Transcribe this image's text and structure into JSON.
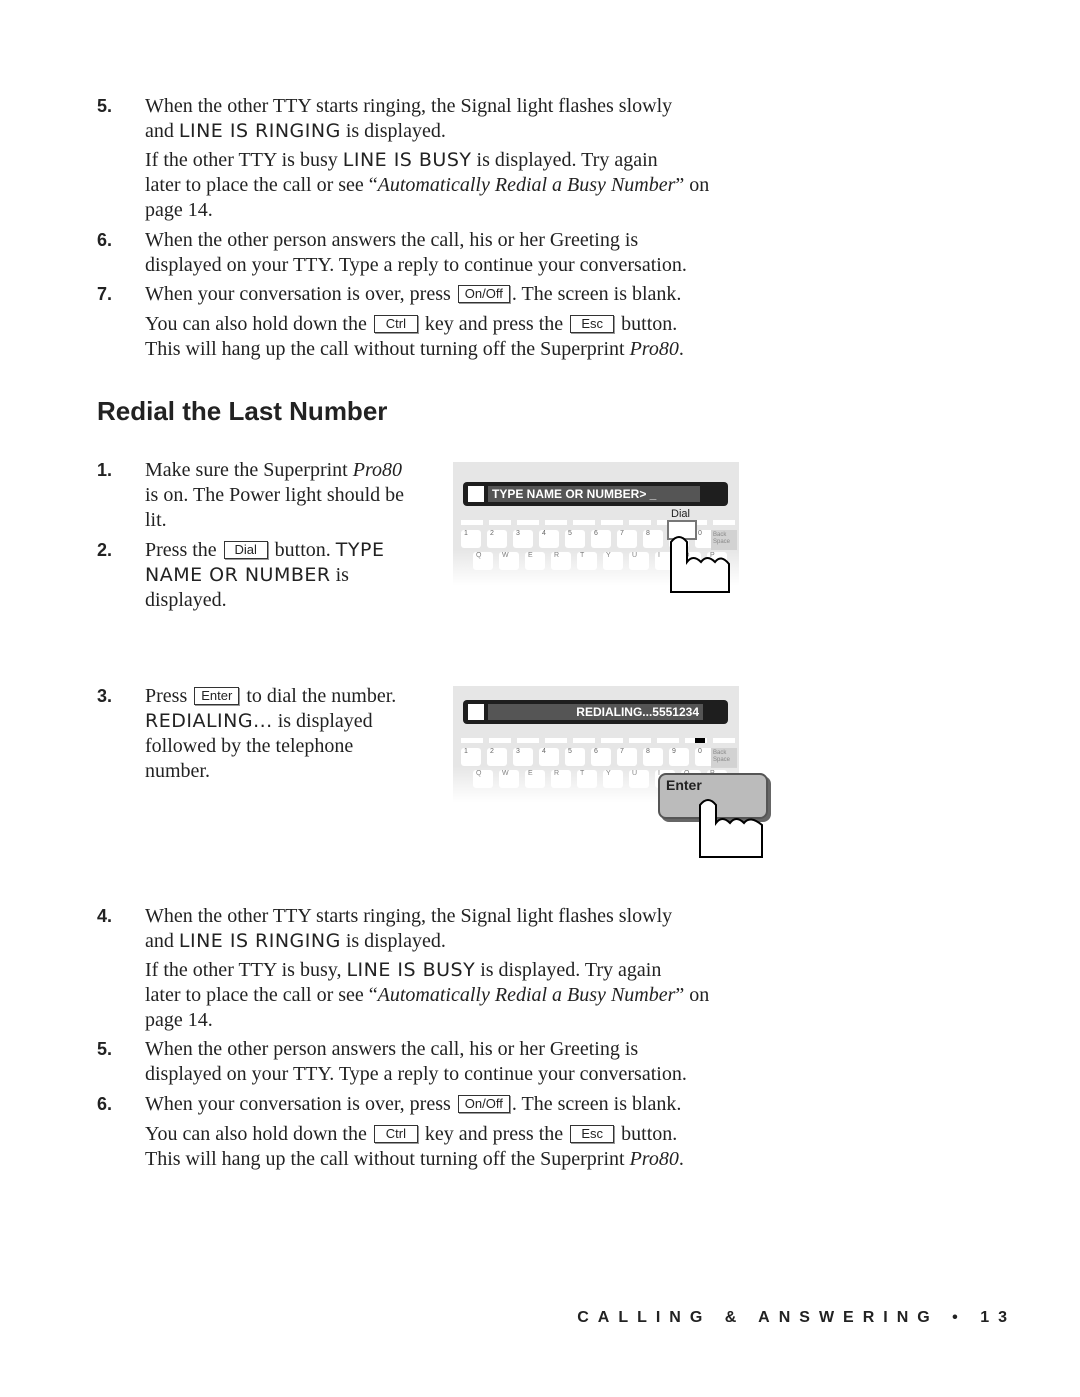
{
  "top_steps": [
    {
      "num": "5.",
      "lines": [
        [
          {
            "text": "When the other TTY starts ringing, the Signal light flashes slowly"
          }
        ],
        [
          {
            "text": "and "
          },
          {
            "lcd": "LINE IS RINGING"
          },
          {
            "text": " is displayed."
          }
        ]
      ]
    },
    {
      "num": "",
      "lines": [
        [
          {
            "text": "If the other TTY is busy "
          },
          {
            "lcd": "LINE IS BUSY"
          },
          {
            "text": " is displayed. Try again"
          }
        ],
        [
          {
            "text": "later to place the call or see “"
          },
          {
            "em": "Automatically Redial a Busy Number"
          },
          {
            "text": "” on"
          }
        ],
        [
          {
            "text": "page 14."
          }
        ]
      ]
    },
    {
      "num": "6.",
      "lines": [
        [
          {
            "text": "When the other person answers the call, his or her Greeting is"
          }
        ],
        [
          {
            "text": "displayed on your TTY. Type a reply to continue your conversation."
          }
        ]
      ]
    },
    {
      "num": "7.",
      "lines": [
        [
          {
            "text": "When your conversation is over, press "
          },
          {
            "key": "On/Off"
          },
          {
            "text": ". The screen is blank."
          }
        ]
      ]
    },
    {
      "num": "",
      "lines": [
        [
          {
            "text": "You can also hold down the "
          },
          {
            "key": "Ctrl"
          },
          {
            "text": " key and press the "
          },
          {
            "key": "Esc"
          },
          {
            "text": " button."
          }
        ],
        [
          {
            "text": "This will hang up the call without turning off the Superprint "
          },
          {
            "em": "Pro80"
          },
          {
            "text": "."
          }
        ]
      ]
    }
  ],
  "heading": "Redial the Last Number",
  "mid_steps": [
    {
      "num": "1.",
      "lines": [
        [
          {
            "text": "Make sure the Superprint "
          },
          {
            "em": "Pro80"
          }
        ],
        [
          {
            "text": "is on. The Power light should be"
          }
        ],
        [
          {
            "text": "lit."
          }
        ]
      ]
    },
    {
      "num": "2.",
      "lines": [
        [
          {
            "text": "Press the "
          },
          {
            "key": "Dial"
          },
          {
            "text": " button. "
          },
          {
            "lcd": "TYPE"
          }
        ],
        [
          {
            "lcd": "NAME OR NUMBER"
          },
          {
            "text": " is"
          }
        ],
        [
          {
            "text": "displayed."
          }
        ]
      ]
    },
    {
      "num": "3.",
      "lines": [
        [
          {
            "text": "Press "
          },
          {
            "key": "Enter"
          },
          {
            "text": " to dial the number."
          }
        ],
        [
          {
            "lcd": "REDIALING..."
          },
          {
            "text": " is displayed"
          }
        ],
        [
          {
            "text": "followed by the telephone"
          }
        ],
        [
          {
            "text": "number."
          }
        ]
      ]
    }
  ],
  "bottom_steps": [
    {
      "num": "4.",
      "lines": [
        [
          {
            "text": "When the other TTY starts ringing, the Signal light flashes slowly"
          }
        ],
        [
          {
            "text": "and "
          },
          {
            "lcd": "LINE IS RINGING"
          },
          {
            "text": " is displayed."
          }
        ]
      ]
    },
    {
      "num": "",
      "lines": [
        [
          {
            "text": "If the other TTY is busy, "
          },
          {
            "lcd": "LINE IS BUSY"
          },
          {
            "text": " is displayed. Try again"
          }
        ],
        [
          {
            "text": "later to place the call or see “"
          },
          {
            "em": "Automatically Redial a Busy Number"
          },
          {
            "text": "” on"
          }
        ],
        [
          {
            "text": "page 14."
          }
        ]
      ]
    },
    {
      "num": "5.",
      "lines": [
        [
          {
            "text": "When the other person answers the call, his or her Greeting is"
          }
        ],
        [
          {
            "text": "displayed on your TTY. Type a reply to continue your conversation."
          }
        ]
      ]
    },
    {
      "num": "6.",
      "lines": [
        [
          {
            "text": "When your conversation is over, press "
          },
          {
            "key": "On/Off"
          },
          {
            "text": ". The screen is blank."
          }
        ]
      ]
    },
    {
      "num": "",
      "lines": [
        [
          {
            "text": "You can also hold down the "
          },
          {
            "key": "Ctrl"
          },
          {
            "text": " key and press the "
          },
          {
            "key": "Esc"
          },
          {
            "text": " button."
          }
        ],
        [
          {
            "text": "This will hang up the call without turning off the Superprint "
          },
          {
            "em": "Pro80"
          },
          {
            "text": "."
          }
        ]
      ]
    }
  ],
  "illustration1": {
    "lcd_text": "TYPE NAME OR NUMBER> _",
    "key_label": "Dial",
    "row1": [
      "1",
      "2",
      "3",
      "4",
      "5",
      "6",
      "7",
      "8",
      "9",
      "0"
    ],
    "row2": [
      "Q",
      "W",
      "E",
      "R",
      "T",
      "Y",
      "U",
      "I",
      "O",
      "P"
    ],
    "backspace": "Back Space"
  },
  "illustration2": {
    "lcd_text": "REDIALING...5551234",
    "key_label": "Enter",
    "row1": [
      "1",
      "2",
      "3",
      "4",
      "5",
      "6",
      "7",
      "8",
      "9",
      "0"
    ],
    "row2": [
      "Q",
      "W",
      "E",
      "R",
      "T",
      "Y",
      "U",
      "I",
      "O",
      "P"
    ],
    "backspace": "Back Space"
  },
  "footer": "CALLING & ANSWERING • 13"
}
